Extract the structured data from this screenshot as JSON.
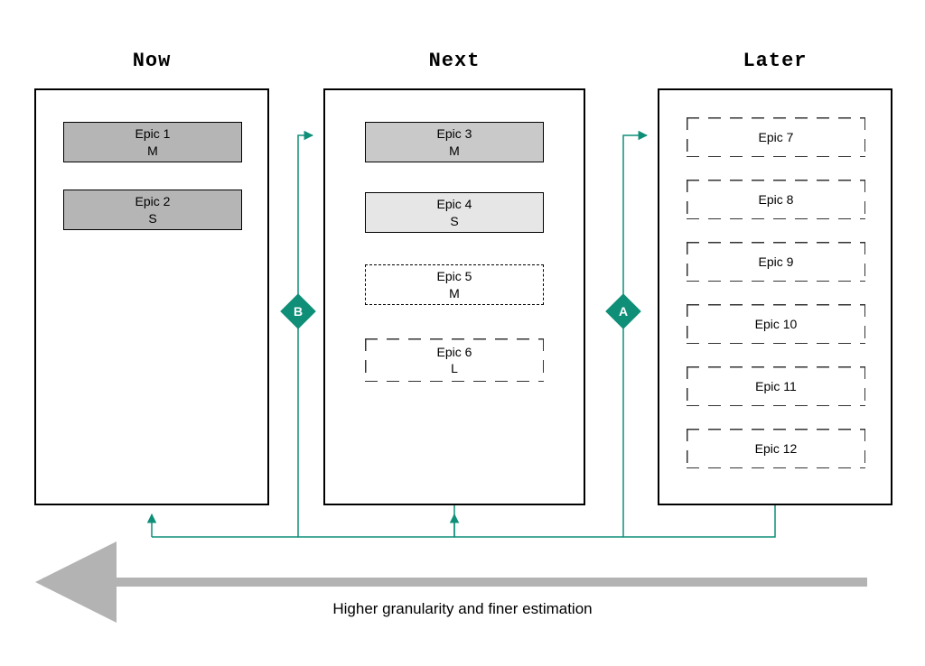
{
  "columns": {
    "now": {
      "title": "Now"
    },
    "next": {
      "title": "Next"
    },
    "later": {
      "title": "Later"
    }
  },
  "epics": {
    "e1": {
      "name": "Epic 1",
      "size": "M"
    },
    "e2": {
      "name": "Epic 2",
      "size": "S"
    },
    "e3": {
      "name": "Epic 3",
      "size": "M"
    },
    "e4": {
      "name": "Epic 4",
      "size": "S"
    },
    "e5": {
      "name": "Epic 5",
      "size": "M"
    },
    "e6": {
      "name": "Epic 6",
      "size": "L"
    },
    "e7": {
      "name": "Epic 7"
    },
    "e8": {
      "name": "Epic 8"
    },
    "e9": {
      "name": "Epic 9"
    },
    "e10": {
      "name": "Epic 10"
    },
    "e11": {
      "name": "Epic 11"
    },
    "e12": {
      "name": "Epic 12"
    }
  },
  "gates": {
    "a": {
      "label": "A"
    },
    "b": {
      "label": "B"
    }
  },
  "caption": "Higher granularity and finer estimation",
  "colors": {
    "accent": "#0f8f78",
    "arrow_gray": "#b3b3b3"
  }
}
